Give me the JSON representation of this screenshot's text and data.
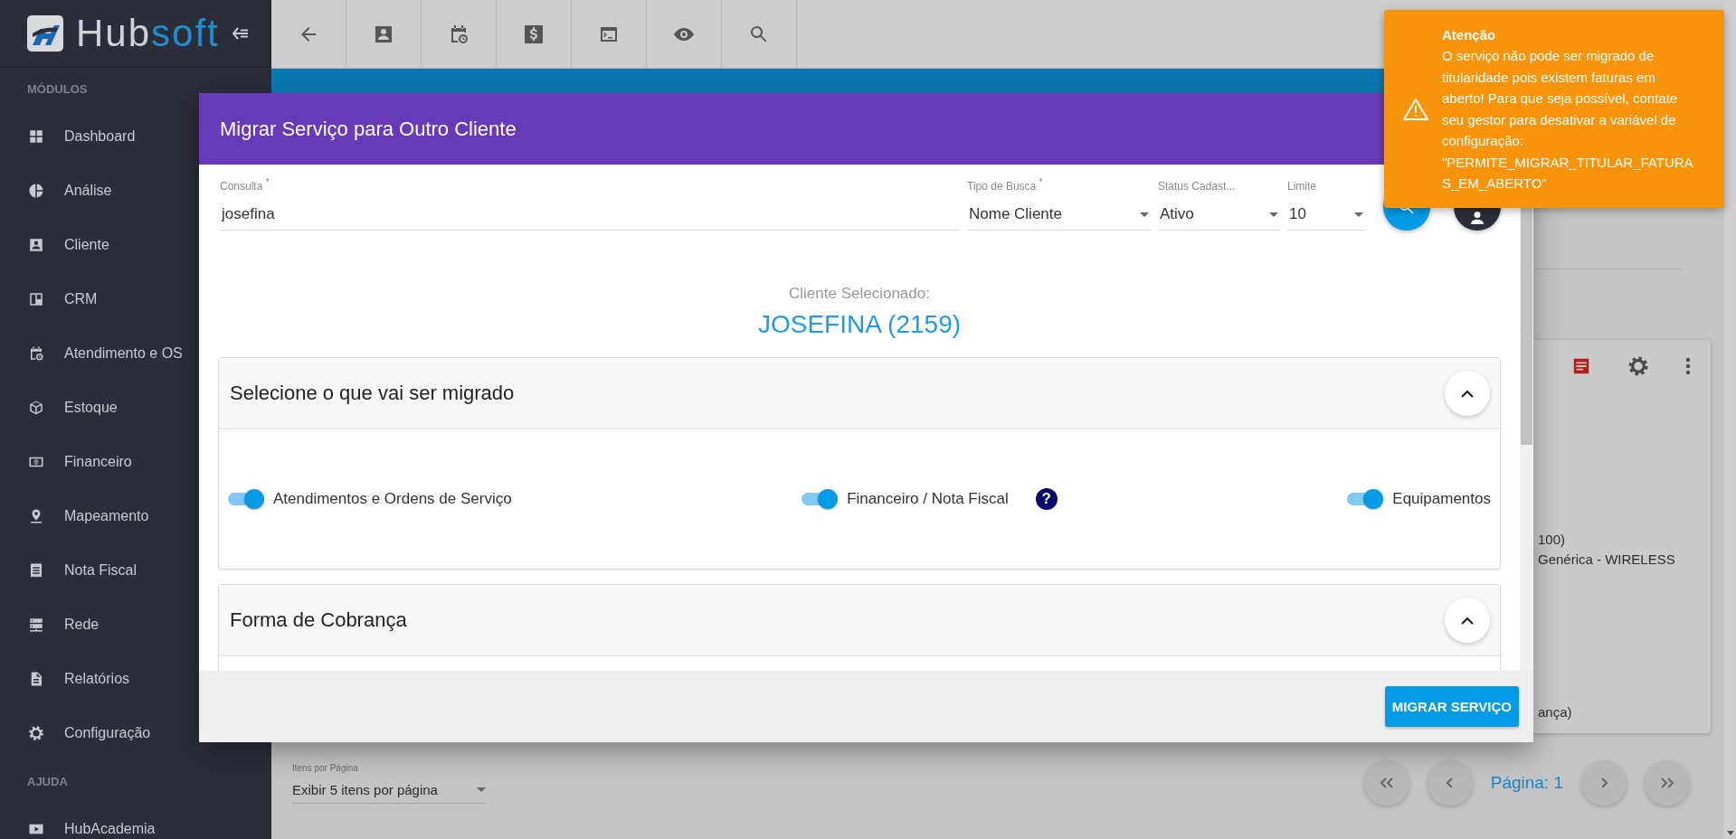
{
  "sidebar": {
    "brand": [
      "Hub",
      "soft"
    ],
    "sections": [
      {
        "title": "MÓDULOS",
        "items": [
          {
            "label": "Dashboard"
          },
          {
            "label": "Análise"
          },
          {
            "label": "Cliente"
          },
          {
            "label": "CRM"
          },
          {
            "label": "Atendimento e OS"
          },
          {
            "label": "Estoque"
          },
          {
            "label": "Financeiro"
          },
          {
            "label": "Mapeamento"
          },
          {
            "label": "Nota Fiscal"
          },
          {
            "label": "Rede"
          },
          {
            "label": "Relatórios"
          },
          {
            "label": "Configuração"
          }
        ]
      },
      {
        "title": "AJUDA",
        "items": [
          {
            "label": "HubAcademia"
          }
        ]
      }
    ]
  },
  "background": {
    "card_lines": [
      "100)",
      "Genérica - WIRELESS",
      "ança)"
    ],
    "items_per_page": {
      "label": "Itens por Página",
      "value": "Exibir 5 itens por página"
    },
    "page_label": "Página: 1"
  },
  "dialog": {
    "title": "Migrar Serviço para Outro Cliente",
    "fields": [
      {
        "kind": "text",
        "label": "Consulta $^{*}$",
        "value": "josefina"
      },
      {
        "kind": "select",
        "label": "Tipo de Busca $^{*}$",
        "value": "Nome Cliente"
      },
      {
        "kind": "select",
        "label": "Status Cadast...",
        "value": "Ativo"
      },
      {
        "kind": "select",
        "label": "Limite",
        "value": "10"
      }
    ],
    "selected_client": {
      "label": "Cliente Selecionado:",
      "name": "JOSEFINA (2159)"
    },
    "panels": [
      {
        "title": "Selecione o que vai ser migrado",
        "expanded": true,
        "options": [
          {
            "label": "Atendimentos e Ordens de Serviço",
            "on": true
          },
          {
            "label": "Financeiro / Nota Fiscal",
            "on": true,
            "help": "?"
          },
          {
            "label": "Equipamentos",
            "on": true
          }
        ]
      },
      {
        "title": "Forma de Cobrança",
        "expanded": true
      }
    ],
    "primary_button": "MIGRAR SERVIÇO"
  },
  "toast": {
    "title": "Atenção",
    "message": "O serviço não pode ser migrado de titularidade pois existem faturas em aberto! Para que seja possível, contate seu gestor para desativar a variável de configuração: \"PERMITE_MIGRAR_TITULAR_FATURAS_EM_ABERTO\""
  }
}
